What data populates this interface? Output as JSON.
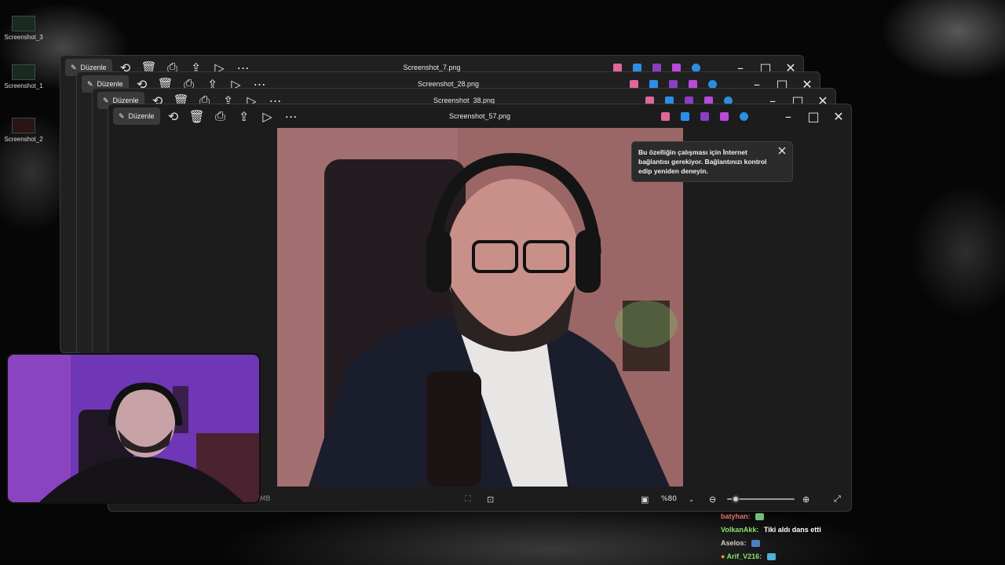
{
  "desktop": {
    "icons": [
      {
        "label": "Screenshot_3"
      },
      {
        "label": "Screenshot_1"
      },
      {
        "label": "Screenshot_2"
      }
    ]
  },
  "windows": [
    {
      "title": "Screenshot_7.png",
      "edit_label": "Düzenle"
    },
    {
      "title": "Screenshot_28.png",
      "edit_label": "Düzenle"
    },
    {
      "title": "Screenshot_38.png",
      "edit_label": "Düzenle"
    },
    {
      "title": "Screenshot_57.png",
      "edit_label": "Düzenle"
    }
  ],
  "toolbar_icons": [
    "rotate-icon",
    "delete-icon",
    "print-icon",
    "share-icon",
    "slideshow-icon",
    "more-icon"
  ],
  "title_apps": [
    {
      "name": "copilot-icon",
      "color": "#e0679a"
    },
    {
      "name": "paint-icon",
      "color": "#2d8ee6"
    },
    {
      "name": "clipchamp-icon",
      "color": "#8a3fbf"
    },
    {
      "name": "designer-icon",
      "color": "#b84ad8"
    },
    {
      "name": "onedrive-icon",
      "color": "#2a8fe0"
    }
  ],
  "toast": {
    "message": "Bu özelliğin çalışması için İnternet bağlantısı gerekiyor. Bağlantınızı kontrol edip yeniden deneyin."
  },
  "statusbar": {
    "file_size": "3 MB",
    "zoom_value": "%80",
    "zoom_level": 0.08
  },
  "chat": [
    {
      "user": "batyhan:",
      "user_color": "#e46d6d",
      "message": ""
    },
    {
      "user": "VolkanAkk:",
      "user_color": "#8ee06e",
      "message": "Tiki aldı dans etti"
    },
    {
      "user": "Aselos:",
      "user_color": "#cfcfcf",
      "message": ""
    },
    {
      "user": "Arif_V216:",
      "user_color": "#8ee06e",
      "message": ""
    }
  ],
  "colors": {
    "window_bg": "#202020",
    "accent": "#2d8ee6"
  }
}
